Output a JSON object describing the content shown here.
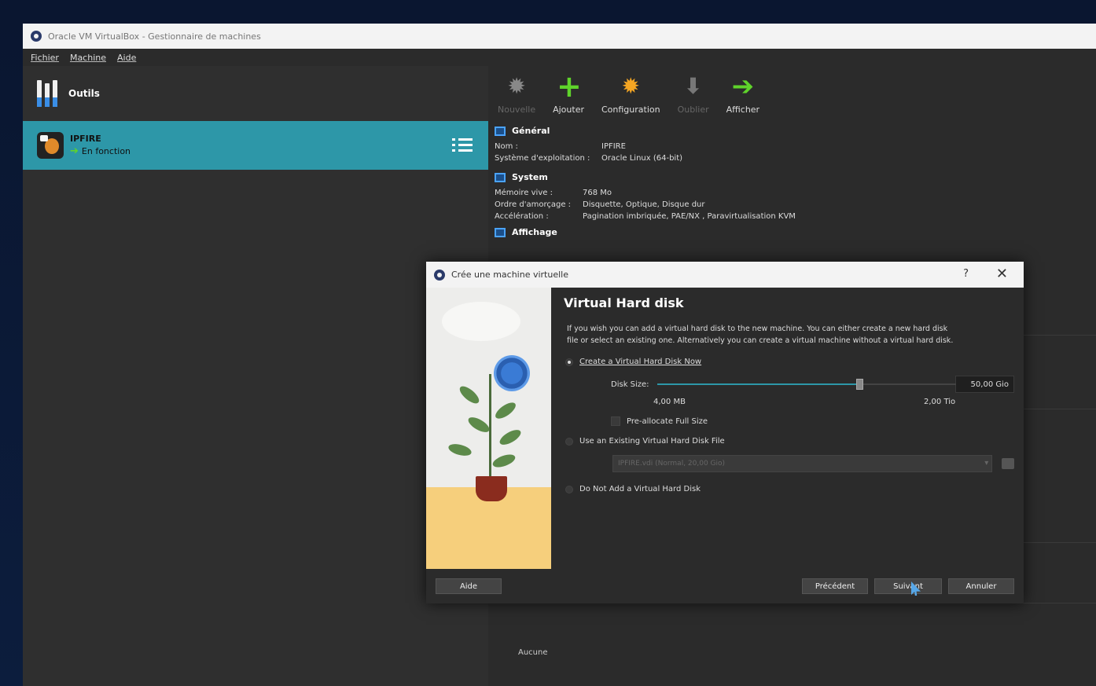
{
  "app": {
    "window_title": "Oracle VM VirtualBox - Gestionnaire de machines",
    "menu": [
      "Fichier",
      "Machine",
      "Aide"
    ]
  },
  "sidebar": {
    "tools_label": "Outils",
    "vm": {
      "name": "IPFIRE",
      "state": "En fonction"
    }
  },
  "toolbar": {
    "new_label": "Nouvelle",
    "add_label": "Ajouter",
    "config_label": "Configuration",
    "discard_label": "Oublier",
    "show_label": "Afficher"
  },
  "details": {
    "general": {
      "title": "Général",
      "name_key": "Nom :",
      "name_val": "IPFIRE",
      "os_key": "Système d'exploitation :",
      "os_val": "Oracle Linux (64-bit)"
    },
    "system": {
      "title": "System",
      "mem_key": "Mémoire vive :",
      "mem_val": "768 Mo",
      "boot_key": "Ordre d'amorçage :",
      "boot_val": "Disquette, Optique, Disque dur",
      "accel_key": "Accélération :",
      "accel_val": "Pagination imbriquée, PAE/NX , Paravirtualisation KVM"
    },
    "display": {
      "title": "Affichage"
    },
    "bottom_text": "Aucune"
  },
  "dialog": {
    "title": "Crée une machine virtuelle",
    "help_glyph": "?",
    "close_glyph": "✕",
    "heading": "Virtual Hard disk",
    "description": "If you wish you can add a virtual hard disk to the new machine. You can either create a new hard disk file or select an existing one. Alternatively you can create a virtual machine without a virtual hard disk.",
    "opt_create": "Create a Virtual Hard Disk Now",
    "disk_size_label": "Disk Size:",
    "disk_size_value": "50,00 Gio",
    "disk_size_fraction": 0.69,
    "scale_min": "4,00 MB",
    "scale_max": "2,00 Tio",
    "preallocate": "Pre-allocate Full Size",
    "opt_existing": "Use an Existing Virtual Hard Disk File",
    "existing_combo": "IPFIRE.vdi (Normal, 20,00 Gio)",
    "opt_none": "Do Not Add a Virtual Hard Disk",
    "btn_help": "Aide",
    "btn_prev": "Précédent",
    "btn_next": "Suivant",
    "btn_cancel": "Annuler"
  }
}
